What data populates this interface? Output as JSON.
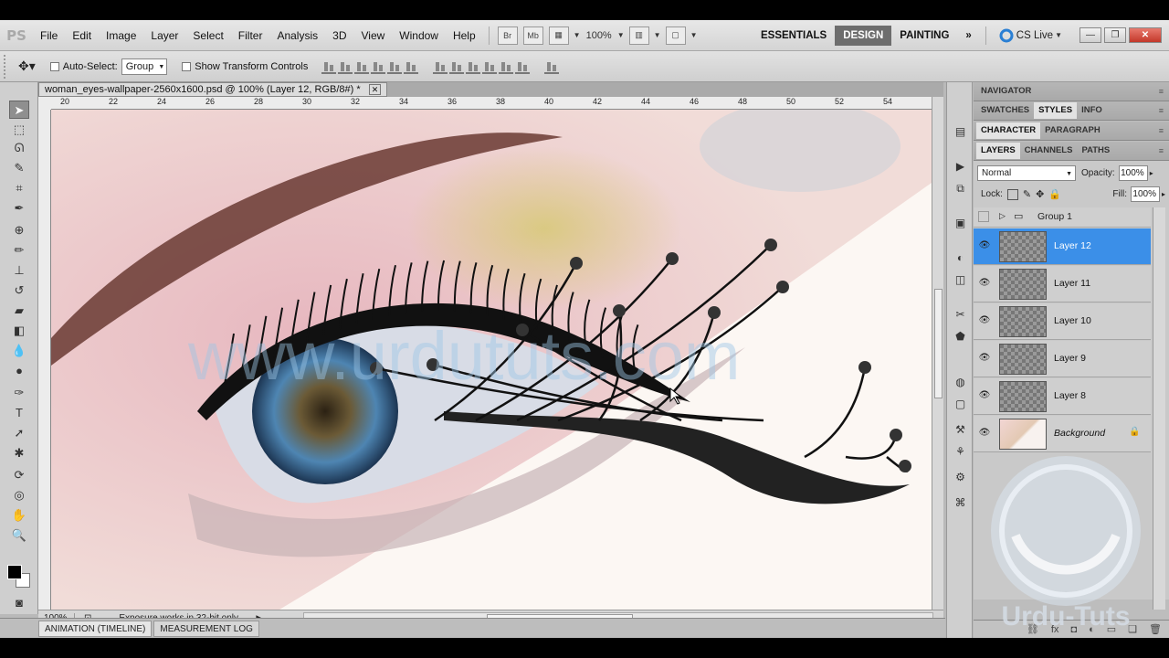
{
  "app": {
    "logo": "PS"
  },
  "menu": [
    "File",
    "Edit",
    "Image",
    "Layer",
    "Select",
    "Filter",
    "Analysis",
    "3D",
    "View",
    "Window",
    "Help"
  ],
  "appbar": {
    "bridge": "Br",
    "minibridge": "Mb",
    "zoom": "100%"
  },
  "workspaces": [
    "ESSENTIALS",
    "DESIGN",
    "PAINTING"
  ],
  "active_workspace": "DESIGN",
  "more_workspaces": "»",
  "cs_live": "CS Live",
  "window_controls": {
    "minimize": "—",
    "restore": "❐",
    "close": "✕"
  },
  "options": {
    "auto_select_label": "Auto-Select:",
    "auto_select_value": "Group",
    "show_transform": "Show Transform Controls"
  },
  "document": {
    "tab_title": "woman_eyes-wallpaper-2560x1600.psd @ 100% (Layer 12, RGB/8#) *",
    "close": "✕",
    "ruler_ticks": [
      "20",
      "22",
      "24",
      "26",
      "28",
      "30",
      "32",
      "34",
      "36",
      "38",
      "40",
      "42",
      "44",
      "46",
      "48",
      "50",
      "52",
      "54"
    ],
    "watermark_text": "www.urdututs.com"
  },
  "status": {
    "zoom": "100%",
    "message": "Exposure works in 32-bit only"
  },
  "bottom_tabs": [
    "ANIMATION (TIMELINE)",
    "MEASUREMENT LOG"
  ],
  "panels": {
    "navigator": [
      "NAVIGATOR"
    ],
    "swatches_group": [
      "SWATCHES",
      "STYLES",
      "INFO"
    ],
    "character_group": [
      "CHARACTER",
      "PARAGRAPH"
    ],
    "layers_group": [
      "LAYERS",
      "CHANNELS",
      "PATHS"
    ],
    "active_tabs": {
      "swatches_group": "STYLES",
      "character_group": "CHARACTER",
      "layers_group": "LAYERS"
    }
  },
  "layers": {
    "blend_mode": "Normal",
    "opacity_label": "Opacity:",
    "opacity": "100%",
    "lock_label": "Lock:",
    "fill_label": "Fill:",
    "fill": "100%",
    "group": "Group 1",
    "items": [
      {
        "name": "Layer 12",
        "selected": true
      },
      {
        "name": "Layer 11",
        "selected": false
      },
      {
        "name": "Layer 10",
        "selected": false
      },
      {
        "name": "Layer 9",
        "selected": false
      },
      {
        "name": "Layer 8",
        "selected": false
      },
      {
        "name": "Background",
        "selected": false,
        "locked": true
      }
    ]
  },
  "brand_watermark": "Urdu-Tuts",
  "colors": {
    "selection": "#3b8fe8",
    "active_workspace_bg": "#6d6d6d",
    "foreground": "#000000",
    "background": "#ffffff"
  }
}
